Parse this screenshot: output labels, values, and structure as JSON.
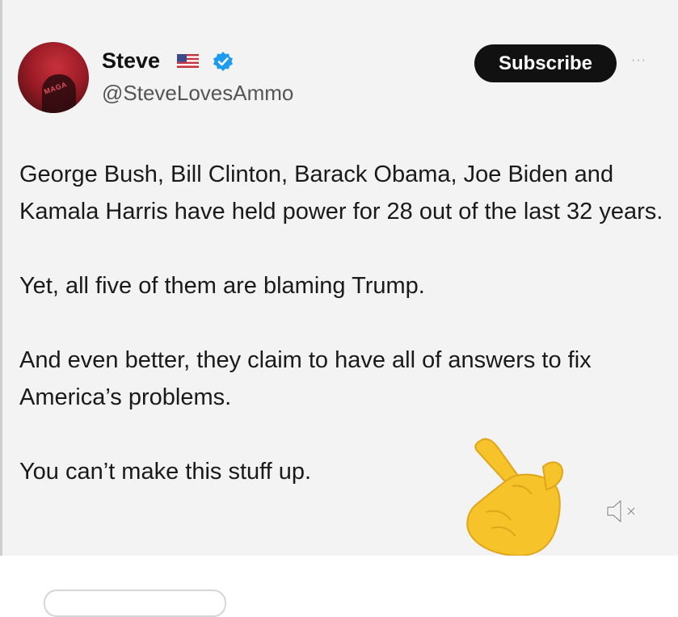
{
  "post": {
    "display_name": "Steve",
    "handle": "@SteveLovesAmmo",
    "subscribe_label": "Subscribe",
    "more_label": "···",
    "icons": [
      "us-flag-icon",
      "verified-badge-icon",
      "mute-icon",
      "pointing-hand-emoji"
    ],
    "body": {
      "paragraph_1": "George Bush, Bill Clinton, Barack Obama, Joe Biden and Kamala Harris have held power for 28 out of the last 32 years.",
      "paragraph_2": "Yet, all five of them are blaming Trump.",
      "paragraph_3": "And even better, they claim to have all of answers to fix America’s problems.",
      "paragraph_4": "You can’t make this stuff up."
    },
    "colors": {
      "card_bg": "#f3f3f3",
      "button_bg": "#111111",
      "verified": "#1d9bf0",
      "emoji": "#f6c32b"
    }
  }
}
